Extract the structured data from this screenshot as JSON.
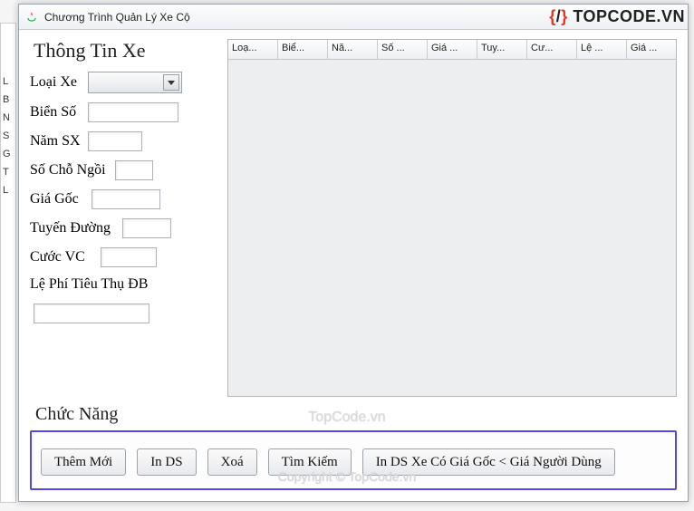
{
  "window": {
    "title": "Chương Trình Quản Lý Xe Cộ"
  },
  "form": {
    "section_title": "Thông Tin Xe",
    "loai_xe": {
      "label": "Loại Xe",
      "value": ""
    },
    "bien_so": {
      "label": "Biển Số",
      "value": ""
    },
    "nam_sx": {
      "label": "Năm SX",
      "value": ""
    },
    "so_cho": {
      "label": "Số Chỗ Ngồi",
      "value": ""
    },
    "gia_goc": {
      "label": "Giá Gốc",
      "value": ""
    },
    "tuyen_duong": {
      "label": "Tuyến Đường",
      "value": ""
    },
    "cuoc_vc": {
      "label": "Cước VC",
      "value": ""
    },
    "le_phi": {
      "label": "Lệ Phí Tiêu Thụ ĐB",
      "value": ""
    },
    "extra": {
      "value": ""
    }
  },
  "table": {
    "columns": [
      "Loạ...",
      "Biể...",
      "Nă...",
      "Số ...",
      "Giá ...",
      "Tuy...",
      "Cư...",
      "Lệ ...",
      "Giá ..."
    ]
  },
  "functions": {
    "section_title": "Chức Năng",
    "buttons": {
      "them_moi": "Thêm Mới",
      "in_ds": "In DS",
      "xoa": "Xoá",
      "tim_kiem": "Tìm Kiếm",
      "in_ds_filter": "In DS Xe Có Giá Gốc < Giá Người Dùng"
    }
  },
  "watermark": {
    "brand": "TOPCODE.VN",
    "center": "TopCode.vn",
    "bottom": "Copyright © TopCode.vn"
  },
  "partial": {
    "lines": [
      "L",
      "B",
      "N",
      "S",
      "G",
      "T",
      "L"
    ]
  }
}
